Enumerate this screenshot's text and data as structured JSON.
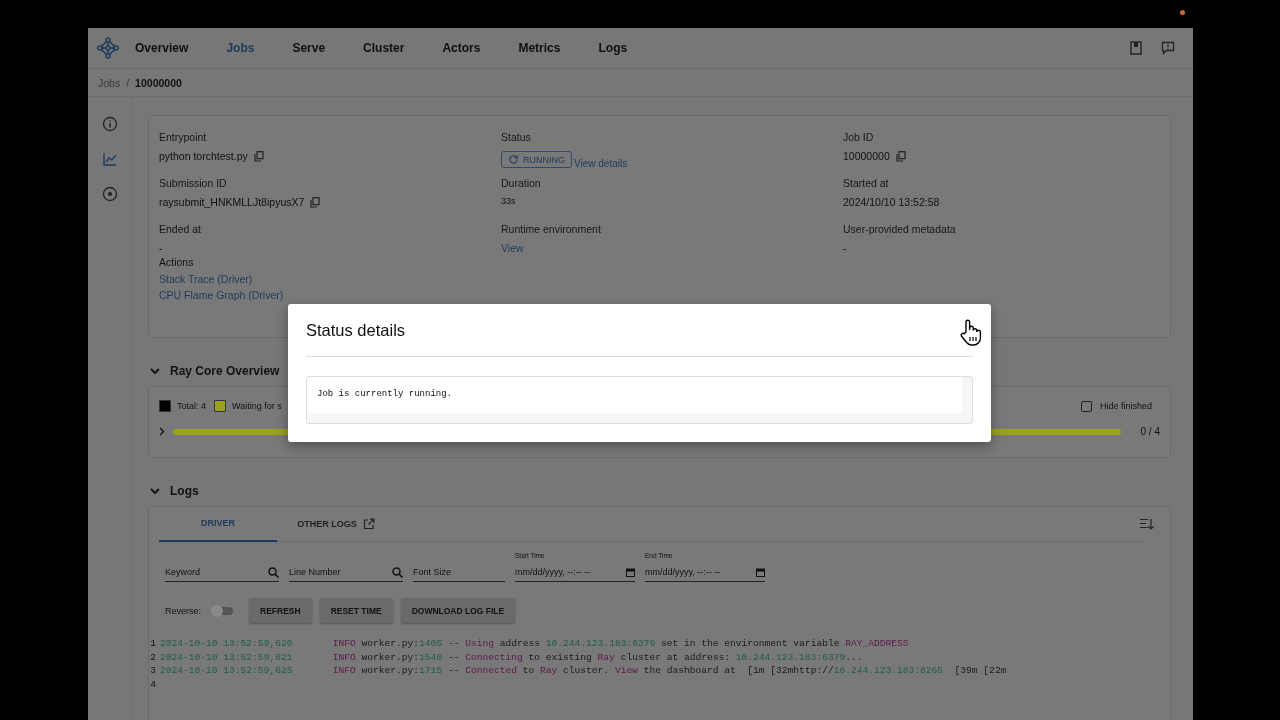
{
  "nav": {
    "items": [
      {
        "label": "Overview",
        "selected": false
      },
      {
        "label": "Jobs",
        "selected": true
      },
      {
        "label": "Serve",
        "selected": false
      },
      {
        "label": "Cluster",
        "selected": false
      },
      {
        "label": "Actors",
        "selected": false
      },
      {
        "label": "Metrics",
        "selected": false
      },
      {
        "label": "Logs",
        "selected": false
      }
    ]
  },
  "breadcrumb": {
    "items": [
      "Jobs",
      "10000000"
    ],
    "separator": "/"
  },
  "job": {
    "fields": [
      {
        "label": "Entrypoint",
        "value": "python torchtest.py",
        "kind": "copy"
      },
      {
        "label": "Status",
        "value": "RUNNING",
        "link": "View details",
        "kind": "status"
      },
      {
        "label": "Job ID",
        "value": "10000000",
        "kind": "copy"
      },
      {
        "label": "Submission ID",
        "value": "raysubmit_HNKMLLJt8ipyusX7",
        "kind": "copy"
      },
      {
        "label": "Duration",
        "value": "33s",
        "kind": "small"
      },
      {
        "label": "Started at",
        "value": "2024/10/10 13:52:58",
        "kind": "text"
      },
      {
        "label": "Ended at",
        "value": "-",
        "kind": "text"
      },
      {
        "label": "Runtime environment",
        "value": "View",
        "kind": "link"
      },
      {
        "label": "User-provided metadata",
        "value": "-",
        "kind": "text"
      }
    ],
    "actions_label": "Actions",
    "actions": [
      "Stack Trace (Driver)",
      "CPU Flame Graph (Driver)"
    ]
  },
  "ray_core": {
    "title": "Ray Core Overview",
    "legend": [
      {
        "label": "Total: 4",
        "color": "#000000"
      },
      {
        "label": "Waiting for s",
        "color": "#9aa21a"
      }
    ],
    "hide_finished": {
      "label": "Hide finished",
      "checked": false
    },
    "progress": {
      "level": 1,
      "reading": "0 / 4"
    }
  },
  "logs": {
    "title": "Logs",
    "tabs": [
      {
        "label": "DRIVER",
        "selected": true
      },
      {
        "label": "OTHER LOGS",
        "selected": false
      }
    ],
    "filters": [
      {
        "placeholder": "Keyword",
        "kind": "search"
      },
      {
        "placeholder": "Line Number",
        "kind": "search"
      },
      {
        "placeholder": "Font Size",
        "kind": "text"
      },
      {
        "label": "Start Time",
        "value": "mm/dd/yyyy, --:-- --",
        "kind": "date"
      },
      {
        "label": "End Time",
        "value": "mm/dd/yyyy, --:-- --",
        "kind": "date"
      }
    ],
    "reverse": {
      "label": "Reverse:",
      "on": false
    },
    "buttons": [
      "REFRESH",
      "RESET TIME",
      "DOWNLOAD LOG FILE"
    ],
    "lines": [
      {
        "number": "1",
        "segments": [
          {
            "t": "2024-10-10 13:52:59,620",
            "kind": "num"
          },
          {
            "t": "       INFO",
            "kind": "kw"
          },
          {
            "t": " worker.py:",
            "kind": "text"
          },
          {
            "t": "1405",
            "kind": "num"
          },
          {
            "t": " -- ",
            "kind": "text"
          },
          {
            "t": "Using",
            "kind": "kw"
          },
          {
            "t": " address ",
            "kind": "text"
          },
          {
            "t": "10.244.123.183:6379",
            "kind": "num"
          },
          {
            "t": " set in the environment variable ",
            "kind": "text"
          },
          {
            "t": "RAY_ADDRESS",
            "kind": "kw"
          }
        ]
      },
      {
        "number": "2",
        "segments": [
          {
            "t": "2024-10-10 13:52:59,621",
            "kind": "num"
          },
          {
            "t": "       INFO",
            "kind": "kw"
          },
          {
            "t": " worker.py:",
            "kind": "text"
          },
          {
            "t": "1540",
            "kind": "num"
          },
          {
            "t": " -- ",
            "kind": "text"
          },
          {
            "t": "Connecting",
            "kind": "kw"
          },
          {
            "t": " to existing ",
            "kind": "text"
          },
          {
            "t": "Ray",
            "kind": "kw"
          },
          {
            "t": " cluster at address: ",
            "kind": "text"
          },
          {
            "t": "10.244.123.183:6379",
            "kind": "num"
          },
          {
            "t": "...",
            "kind": "text"
          }
        ]
      },
      {
        "number": "3",
        "segments": [
          {
            "t": "2024-10-10 13:52:59,625",
            "kind": "num"
          },
          {
            "t": "       INFO",
            "kind": "kw"
          },
          {
            "t": " worker.py:",
            "kind": "text"
          },
          {
            "t": "1715",
            "kind": "num"
          },
          {
            "t": " -- ",
            "kind": "text"
          },
          {
            "t": "Connected",
            "kind": "kw"
          },
          {
            "t": " to ",
            "kind": "text"
          },
          {
            "t": "Ray",
            "kind": "kw"
          },
          {
            "t": " cluster. ",
            "kind": "text"
          },
          {
            "t": "View",
            "kind": "kw"
          },
          {
            "t": " the dashboard at  [1m [32mhttp://",
            "kind": "text"
          },
          {
            "t": "10.244.123.183:8265",
            "kind": "num"
          },
          {
            "t": "  [39m [22m",
            "kind": "text"
          }
        ]
      },
      {
        "number": "4"
      }
    ]
  },
  "dialog": {
    "title": "Status details",
    "message": "Job is currently running."
  }
}
